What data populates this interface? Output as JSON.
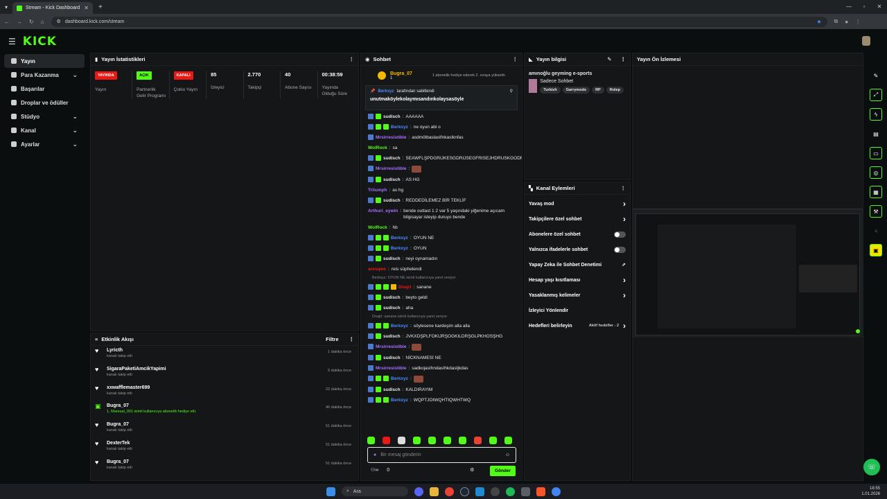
{
  "browser": {
    "tab_title": "Stream - Kick Dashboard",
    "url": "dashboard.kick.com/stream"
  },
  "brand": {
    "logo": "KICK",
    "accent": "#53fc18"
  },
  "sidebar": {
    "items": [
      {
        "label": "Yayın",
        "active": true,
        "chevron": false
      },
      {
        "label": "Para Kazanma",
        "chevron": true
      },
      {
        "label": "Başarılar",
        "chevron": false
      },
      {
        "label": "Droplar ve ödüller",
        "chevron": false
      },
      {
        "label": "Stüdyo",
        "chevron": true
      },
      {
        "label": "Kanal",
        "chevron": true
      },
      {
        "label": "Ayarlar",
        "chevron": true
      }
    ]
  },
  "stats": {
    "title": "Yayın İstatistikleri",
    "items": [
      {
        "badge": "YAYINDA",
        "badge_color": "#e91916",
        "label": "Yayın"
      },
      {
        "badge": "AÇIK",
        "badge_color": "#53fc18",
        "label": "Partnerlik Gelir Programı"
      },
      {
        "badge": "KAPALI",
        "badge_color": "#e91916",
        "label": "Çoklu Yayın"
      },
      {
        "value": "85",
        "label": "İzleyici"
      },
      {
        "value": "2.770",
        "label": "Takipçi"
      },
      {
        "value": "40",
        "label": "Abone Sayısı"
      },
      {
        "value": "00:38:59",
        "label": "Yayında Olduğu Süre"
      }
    ]
  },
  "feed": {
    "title": "Etkinlik Akışı",
    "filter": "Filtre",
    "items": [
      {
        "name": "Lyricth",
        "sub": "kanalı takip etti",
        "time": "1 dakika önce"
      },
      {
        "name": "SigaraPaketiAmcikYapimi",
        "sub": "kanalı takip etti",
        "time": "5 dakika önce"
      },
      {
        "name": "xxwafflemaster699",
        "sub": "kanalı takip etti",
        "time": "22 dakika önce"
      },
      {
        "name": "Bugra_07",
        "sub": "1, Maresal_001 isimli kullanıcıya abonelik hediye etti.",
        "time": "46 dakika önce",
        "gift": true
      },
      {
        "name": "Bugra_07",
        "sub": "kanalı takip etti",
        "time": "51 dakika önce"
      },
      {
        "name": "DexterTek",
        "sub": "kanalı takip etti",
        "time": "51 dakika önce"
      },
      {
        "name": "Bugra_07",
        "sub": "kanalı takip etti",
        "time": "51 dakika önce"
      }
    ]
  },
  "chat": {
    "title": "Sohbet",
    "gifter": "Bugra_07",
    "gifter_count": "1",
    "gifter_note": "1 abonelik hediye ederek 2. sıraya yükselin",
    "pinned_by": "Berkxyz",
    "pinned_by_note": "tarafından sabitlendi",
    "pinned_msg": "unutmaköylekolaymısandınkolaysasöyle",
    "messages": [
      {
        "user": "sudisch",
        "color": "#e8e8e8",
        "text": "AAAAAA",
        "badges": 2
      },
      {
        "user": "Berkxyz",
        "color": "#4b8cff",
        "text": "ne oyun abi o",
        "badges": 3
      },
      {
        "user": "Mrsirresistible",
        "color": "#a970ff",
        "text": "asdmölbaslasIfnkasIknfas",
        "badges": 1
      },
      {
        "user": "WolRock",
        "color": "#53fc18",
        "text": "sa",
        "badges": 0
      },
      {
        "user": "sudisch",
        "color": "#e8e8e8",
        "text": "SEAWFLŞPDGRIJKESGDRIJSEGFRISEJHDRUSKGODFISELGJISLŞOKHRUSRH",
        "badges": 2
      },
      {
        "user": "Mrsirresistible",
        "color": "#a970ff",
        "text": "",
        "badges": 1,
        "emote": true
      },
      {
        "user": "sudisch",
        "color": "#e8e8e8",
        "text": "AS HG",
        "badges": 2
      },
      {
        "user": "Triiumph",
        "color": "#a970ff",
        "text": "as hg",
        "badges": 0
      },
      {
        "user": "sudisch",
        "color": "#e8e8e8",
        "text": "REDDEDİLEMEZ BİR TEKLİF",
        "badges": 2
      },
      {
        "user": "Arthuri_eywin",
        "color": "#a970ff",
        "text": "bende outlast 1 2 var 5 yaşındaki yiğenime açıcam bilgisayar isteyip duruyo bende",
        "badges": 0
      },
      {
        "user": "WolRock",
        "color": "#53fc18",
        "text": "hb",
        "badges": 0
      },
      {
        "user": "Berkxyz",
        "color": "#4b8cff",
        "text": "OYUN NE",
        "badges": 3
      },
      {
        "user": "Berkxyz",
        "color": "#4b8cff",
        "text": "OYUN",
        "badges": 3
      },
      {
        "user": "sudisch",
        "color": "#e8e8e8",
        "text": "neyi oynamadın",
        "badges": 2
      },
      {
        "user": "aresqwe",
        "color": "#e91916",
        "text": "reis süphelendi",
        "badges": 0
      },
      {
        "reply": "Berkxyz: OYUN NE isimli kullanıcıya yanıt veriyor"
      },
      {
        "user": "Dnajrl",
        "color": "#e91916",
        "text": "sanane",
        "badges": 4
      },
      {
        "user": "sudisch",
        "color": "#e8e8e8",
        "text": "beyto geldi",
        "badges": 2
      },
      {
        "user": "sudisch",
        "color": "#e8e8e8",
        "text": "aha",
        "badges": 2
      },
      {
        "reply": "Dnajrl: sanane isimli kullanıcıya yanıt veriyor"
      },
      {
        "user": "Berkxyz",
        "color": "#4b8cff",
        "text": "söylesene kardeşim alla alla",
        "badges": 3
      },
      {
        "user": "sudisch",
        "color": "#e8e8e8",
        "text": "JVKXDŞPLFOKIJRŞOGKILDRŞGLPKHOSŞHG",
        "badges": 2
      },
      {
        "user": "Mrsirresistible",
        "color": "#a970ff",
        "text": "",
        "badges": 1,
        "emote": true
      },
      {
        "user": "sudisch",
        "color": "#e8e8e8",
        "text": "NİCKNAMESİ NE",
        "badges": 2
      },
      {
        "user": "Mrsirresistible",
        "color": "#a970ff",
        "text": "sadkojasIhndasIhkdasIjkdas",
        "badges": 1
      },
      {
        "user": "Berkxyz",
        "color": "#4b8cff",
        "text": "",
        "badges": 3,
        "emote": true
      },
      {
        "user": "sudisch",
        "color": "#e8e8e8",
        "text": "KALDIRAYIM",
        "badges": 2
      },
      {
        "user": "Berkxyz",
        "color": "#4b8cff",
        "text": "WQPTJOIWQHTIQWHTWQ",
        "badges": 3
      }
    ],
    "placeholder": "Bir mesaj gönderin",
    "send": "Gönder",
    "points": "0"
  },
  "info": {
    "title": "Yayın bilgisi",
    "stream_title": "amınoğlu geyming e-sports",
    "category": "Sadece Sohbet",
    "tags": [
      "Turkish",
      "Garrymods",
      "RP",
      "Rolep"
    ]
  },
  "actions": {
    "title": "Kanal Eylemleri",
    "items": [
      {
        "label": "Yavaş mod",
        "type": "chevron"
      },
      {
        "label": "Takipçilere özel sohbet",
        "type": "chevron"
      },
      {
        "label": "Abonelere özel sohbet",
        "type": "toggle"
      },
      {
        "label": "Yalnızca ifadelerle sohbet",
        "type": "toggle"
      },
      {
        "label": "Yapay Zeka ile Sohbet Denetimi",
        "type": "ext"
      },
      {
        "label": "Hesap yaşı kısıtlaması",
        "type": "chevron"
      },
      {
        "label": "Yasaklanmış kelimeler",
        "type": "chevron"
      },
      {
        "label": "İzleyici Yönlendir",
        "type": "none"
      },
      {
        "label": "Hedefleri belirleyin",
        "type": "chevron",
        "extra": "Aktif hedefler - 2"
      }
    ]
  },
  "preview": {
    "title": "Yayın Ön İzlemesi"
  },
  "taskbar": {
    "search": "Ara",
    "time": "18:55",
    "date": "1.01.2026"
  }
}
